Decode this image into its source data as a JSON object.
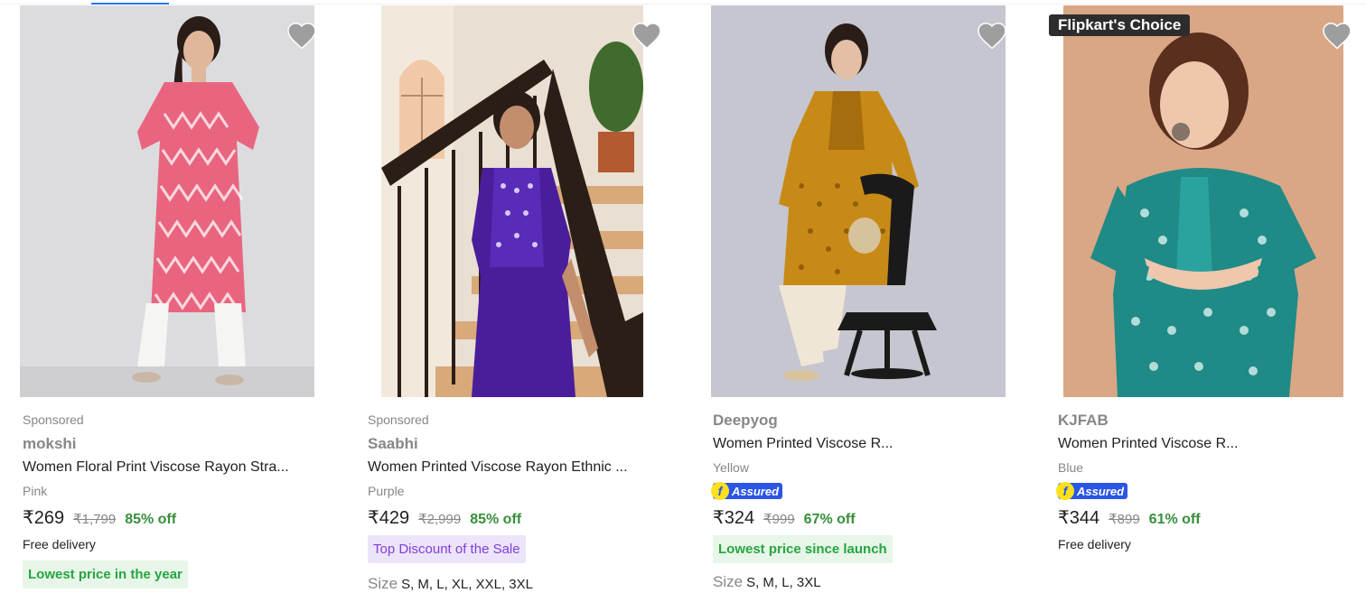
{
  "products": [
    {
      "sponsored": "Sponsored",
      "brand": "mokshi",
      "title": "Women Floral Print Viscose Rayon Stra...",
      "color": "Pink",
      "price": "₹269",
      "mrp": "₹1,799",
      "discount": "85% off",
      "delivery": "Free delivery",
      "tag": "Lowest price in the year",
      "wishlist_icon": "heart-icon"
    },
    {
      "sponsored": "Sponsored",
      "brand": "Saabhi",
      "title": "Women Printed Viscose Rayon Ethnic ...",
      "color": "Purple",
      "price": "₹429",
      "mrp": "₹2,999",
      "discount": "85% off",
      "tag": "Top Discount of the Sale",
      "size_label": "Size",
      "sizes": "S, M, L, XL, XXL, 3XL",
      "wishlist_icon": "heart-icon"
    },
    {
      "brand": "Deepyog",
      "title": "Women Printed Viscose R...",
      "color": "Yellow",
      "assured": "Assured",
      "price": "₹324",
      "mrp": "₹999",
      "discount": "67% off",
      "tag": "Lowest price since launch",
      "size_label": "Size",
      "sizes": "S, M, L, 3XL",
      "wishlist_icon": "heart-icon"
    },
    {
      "badge": "Flipkart's Choice",
      "brand": "KJFAB",
      "title": "Women Printed Viscose R...",
      "color": "Blue",
      "assured": "Assured",
      "price": "₹344",
      "mrp": "₹899",
      "discount": "61% off",
      "delivery": "Free delivery",
      "wishlist_icon": "heart-icon"
    }
  ],
  "colors": {
    "discount_green": "#388e3c",
    "tag_green_bg": "#e7f6e8",
    "tag_green_text": "#26a541",
    "tag_purple_bg": "#ece4fb",
    "tag_purple_text": "#7f3fd8",
    "assured_blue": "#2a55e5",
    "accent_blue": "#2874f0",
    "muted_text": "#878787"
  }
}
